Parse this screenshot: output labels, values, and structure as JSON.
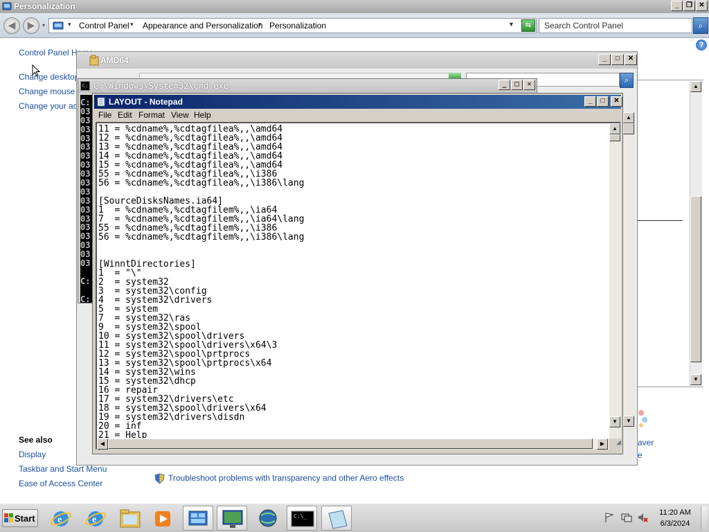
{
  "control_panel": {
    "title": "Personalization",
    "breadcrumb": [
      "Control Panel",
      "Appearance and Personalization",
      "Personalization"
    ],
    "search_placeholder": "Search Control Panel",
    "left_links": [
      "Control Panel Home",
      "Change desktop ic",
      "Change mouse po",
      "Change your acc"
    ],
    "see_also": {
      "heading": "See also",
      "links": [
        "Display",
        "Taskbar and Start Menu",
        "Ease of Access Center"
      ]
    },
    "troubleshoot_link": "Troubleshoot problems with transparency and other Aero effects",
    "partial_right_text": "aver",
    "partial_right_text2": "e"
  },
  "folder_window": {
    "title": "AMD64"
  },
  "cmd_window": {
    "title": "C:\\Windows\\System32\\cmd.exe",
    "lines": [
      "C:",
      "03",
      "03",
      "03",
      "03",
      "03",
      "03",
      "03",
      "03",
      "03",
      "03",
      "03",
      "03",
      "03",
      "03",
      "03",
      "03",
      "03",
      "03",
      "",
      "C:",
      "",
      "C:"
    ]
  },
  "notepad": {
    "title": "LAYOUT - Notepad",
    "menu": [
      "File",
      "Edit",
      "Format",
      "View",
      "Help"
    ],
    "text": "11 = %cdname%,%cdtagfilea%,,\\amd64\n12 = %cdname%,%cdtagfilea%,,\\amd64\n13 = %cdname%,%cdtagfilea%,,\\amd64\n14 = %cdname%,%cdtagfilea%,,\\amd64\n15 = %cdname%,%cdtagfilea%,,\\amd64\n55 = %cdname%,%cdtagfilea%,,\\i386\n56 = %cdname%,%cdtagfilea%,,\\i386\\lang\n\n[SourceDisksNames.ia64]\n1  = %cdname%,%cdtagfilem%,,\\ia64\n7  = %cdname%,%cdtagfilem%,,\\ia64\\lang\n55 = %cdname%,%cdtagfilem%,,\\i386\n56 = %cdname%,%cdtagfilem%,,\\i386\\lang\n\n\n[WinntDirectories]\n1  = \"\\\"\n2  = system32\n3  = system32\\config\n4  = system32\\drivers\n5  = system\n7  = system32\\ras\n9  = system32\\spool\n10 = system32\\spool\\drivers\n11 = system32\\spool\\drivers\\x64\\3\n12 = system32\\spool\\prtprocs\n13 = system32\\spool\\prtprocs\\x64\n14 = system32\\wins\n15 = system32\\dhcp\n16 = repair\n17 = system32\\drivers\\etc\n18 = system32\\spool\\drivers\\x64\n19 = system32\\drivers\\disdn\n20 = inf\n21 = Help"
  },
  "taskbar": {
    "start_label": "Start",
    "apps": [
      "internet-explorer-icon",
      "internet-explorer-icon",
      "folder-icon",
      "media-player-icon",
      "control-panel-icon",
      "monitor-icon",
      "globe-icon",
      "cmd-icon",
      "notepad-icon"
    ],
    "time": "11:20 AM",
    "date": "6/3/2024"
  }
}
